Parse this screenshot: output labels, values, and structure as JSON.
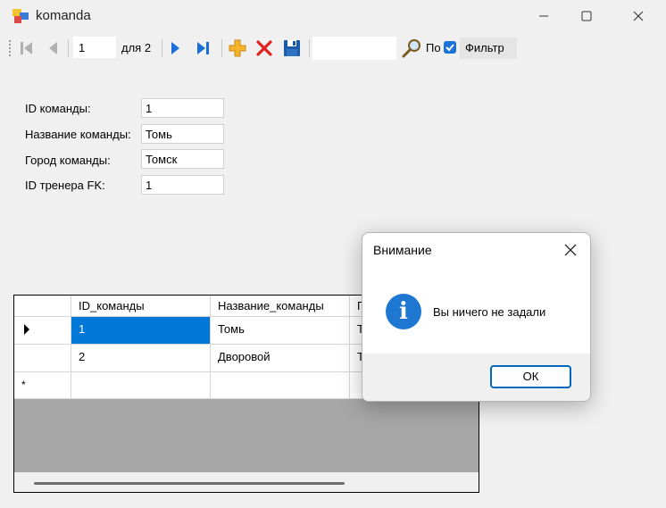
{
  "window": {
    "title": "komanda"
  },
  "navigator": {
    "position": "1",
    "count_label": "для 2",
    "search_partial": "По",
    "filter_label": "Фильтр"
  },
  "form": {
    "fields": [
      {
        "label": "ID команды:",
        "value": "1"
      },
      {
        "label": "Название команды:",
        "value": "Томь"
      },
      {
        "label": "Город команды:",
        "value": "Томск"
      },
      {
        "label": "ID тренера FK:",
        "value": "1"
      }
    ]
  },
  "grid": {
    "columns": [
      "ID_команды",
      "Название_команды",
      "Г"
    ],
    "rows": [
      [
        "1",
        "Томь",
        "Т"
      ],
      [
        "2",
        "Дворовой",
        "Т"
      ]
    ],
    "new_row_marker": "*"
  },
  "dialog": {
    "title": "Внимание",
    "message": "Вы ничего не задали",
    "ok_label": "ОК"
  },
  "colors": {
    "accent": "#0078d7",
    "info": "#1e78d2",
    "delete": "#e02020",
    "add": "#f2a81d",
    "save": "#1a5aa6"
  }
}
